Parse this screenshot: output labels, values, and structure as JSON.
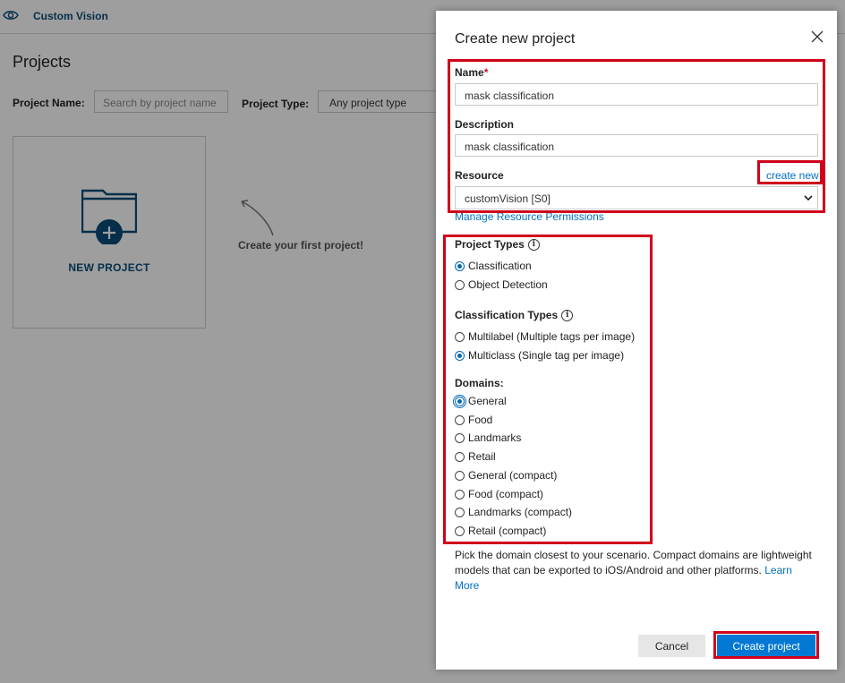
{
  "app": {
    "brand": "Custom Vision",
    "page_title": "Projects",
    "filters": {
      "name_label": "Project Name:",
      "name_placeholder": "Search by project name",
      "type_label": "Project Type:",
      "type_value": "Any project type"
    },
    "new_project_label": "NEW PROJECT",
    "first_project_hint": "Create your first project!"
  },
  "dialog": {
    "title": "Create new project",
    "name": {
      "label": "Name",
      "required_mark": "*",
      "value": "mask classification"
    },
    "description": {
      "label": "Description",
      "value": "mask classification"
    },
    "resource": {
      "label": "Resource",
      "create_new": "create new",
      "value": "customVision [S0]"
    },
    "manage_permissions": "Manage Resource Permissions",
    "project_types": {
      "label": "Project Types",
      "options": [
        {
          "label": "Classification",
          "selected": true
        },
        {
          "label": "Object Detection",
          "selected": false
        }
      ]
    },
    "classification_types": {
      "label": "Classification Types",
      "options": [
        {
          "label": "Multilabel (Multiple tags per image)",
          "selected": false
        },
        {
          "label": "Multiclass (Single tag per image)",
          "selected": true
        }
      ]
    },
    "domains": {
      "label": "Domains:",
      "options": [
        {
          "label": "General",
          "selected": true
        },
        {
          "label": "Food",
          "selected": false
        },
        {
          "label": "Landmarks",
          "selected": false
        },
        {
          "label": "Retail",
          "selected": false
        },
        {
          "label": "General (compact)",
          "selected": false
        },
        {
          "label": "Food (compact)",
          "selected": false
        },
        {
          "label": "Landmarks (compact)",
          "selected": false
        },
        {
          "label": "Retail (compact)",
          "selected": false
        }
      ]
    },
    "help_text": "Pick the domain closest to your scenario. Compact domains are lightweight models that can be exported to iOS/Android and other platforms.",
    "learn_more": "Learn More",
    "cancel_label": "Cancel",
    "create_label": "Create project"
  },
  "colors": {
    "accent": "#0078d4",
    "link": "#0070c0",
    "highlight": "#d0021b",
    "brand": "#0b4d7a"
  }
}
